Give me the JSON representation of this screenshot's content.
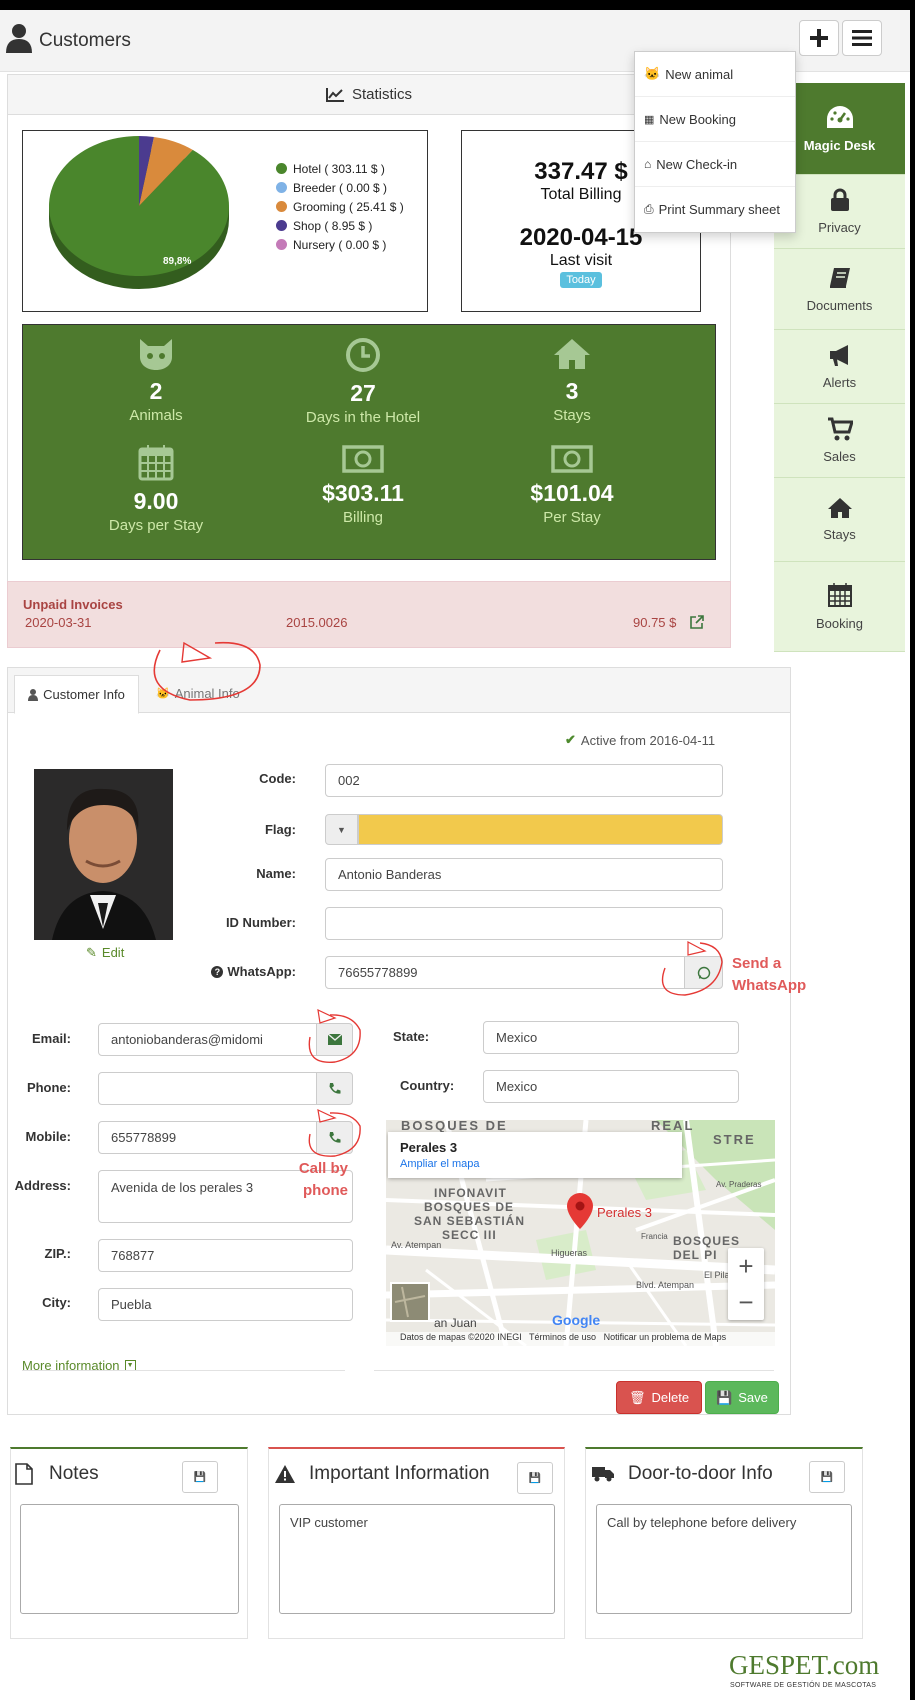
{
  "header": {
    "title": "Customers"
  },
  "menu": {
    "items": [
      "New animal",
      "New Booking",
      "New Check-in",
      "Print Summary sheet"
    ]
  },
  "statistics": {
    "title": "Statistics"
  },
  "chart_data": {
    "type": "pie",
    "categories": [
      "Hotel",
      "Breeder",
      "Grooming",
      "Shop",
      "Nursery"
    ],
    "values": [
      303.11,
      0.0,
      25.41,
      8.95,
      0.0
    ],
    "legend_labels": [
      "Hotel ( 303.11 $ )",
      "Breeder ( 0.00 $ )",
      "Grooming ( 25.41 $ )",
      "Shop ( 8.95 $ )",
      "Nursery ( 0.00 $ )"
    ],
    "colors": [
      "#4a862c",
      "#7fb2e6",
      "#d98a3c",
      "#4b3b8f",
      "#c47ab8"
    ],
    "slice_label": "89,8%",
    "legend_position": "right"
  },
  "summary": {
    "billing_value": "337.47 $",
    "billing_label": "Total Billing",
    "visit_value": "2020-04-15",
    "visit_label": "Last visit",
    "badge": "Today"
  },
  "stats": [
    {
      "num": "2",
      "label": "Animals",
      "icon": "cat-icon"
    },
    {
      "num": "27",
      "label": "Days in the Hotel",
      "icon": "clock-icon"
    },
    {
      "num": "3",
      "label": "Stays",
      "icon": "home-icon"
    },
    {
      "num": "9.00",
      "label": "Days per Stay",
      "icon": "calendar-icon"
    },
    {
      "num": "$303.11",
      "label": "Billing",
      "icon": "money-icon"
    },
    {
      "num": "$101.04",
      "label": "Per Stay",
      "icon": "money-icon"
    }
  ],
  "sidebar": {
    "items": [
      "Magic Desk",
      "Privacy",
      "Documents",
      "Alerts",
      "Sales",
      "Stays",
      "Booking"
    ]
  },
  "invoices": {
    "title": "Unpaid Invoices",
    "date": "2020-03-31",
    "number": "2015.0026",
    "amount": "90.75 $"
  },
  "tabs": {
    "customer": "Customer Info",
    "animal": "Animal Info"
  },
  "status": {
    "active": "Active from 2016-04-11"
  },
  "photo": {
    "edit": "Edit"
  },
  "form": {
    "code_label": "Code:",
    "code": "002",
    "flag_label": "Flag:",
    "flag_color": "#f2c94c",
    "name_label": "Name:",
    "name": "Antonio Banderas",
    "id_label": "ID Number:",
    "id": "",
    "whatsapp_label": "WhatsApp:",
    "whatsapp": "76655778899",
    "email_label": "Email:",
    "email": "antoniobanderas@midomi",
    "phone_label": "Phone:",
    "phone": "",
    "mobile_label": "Mobile:",
    "mobile": "655778899",
    "address_label": "Address:",
    "address": "Avenida de los perales 3",
    "zip_label": "ZIP.:",
    "zip": "768877",
    "city_label": "City:",
    "city": "Puebla",
    "state_label": "State:",
    "state": "Mexico",
    "country_label": "Country:",
    "country": "Mexico"
  },
  "map": {
    "place": "Perales 3",
    "enlarge": "Ampliar el mapa",
    "marker_label": "Perales 3",
    "footer": "Datos de mapas ©2020 INEGI   Términos de uso   Notificar un problema de Maps",
    "brand": "Google",
    "labels": [
      "BOSQUES DE",
      "REAL",
      "STRE",
      "INFONAVIT",
      "BOSQUES DE",
      "SAN SEBASTIÁN",
      "SECC III",
      "BOSQUES",
      "DEL PI",
      "Av. Atempan",
      "Higueras",
      "Blvd. Atempan",
      "El Pilar",
      "an Juan",
      "Francia",
      "Av. Praderas"
    ]
  },
  "annotations": {
    "whatsapp": "Send a WhatsApp",
    "phone": "Call by phone"
  },
  "more": "More information",
  "buttons": {
    "delete": "Delete",
    "save": "Save"
  },
  "notes": {
    "title": "Notes",
    "text": ""
  },
  "important": {
    "title": "Important Information",
    "text": "VIP customer"
  },
  "door": {
    "title": "Door-to-door Info",
    "text": "Call by telephone before delivery"
  },
  "footer": {
    "brand": "GESPET.com",
    "tagline": "SOFTWARE DE GESTIÓN DE MASCOTAS"
  }
}
